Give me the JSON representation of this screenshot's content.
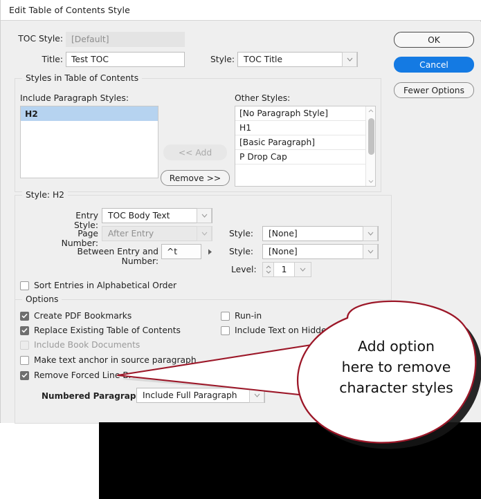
{
  "window": {
    "title": "Edit Table of Contents Style"
  },
  "top": {
    "toc_style_label": "TOC Style:",
    "toc_style_value": "[Default]",
    "title_label": "Title:",
    "title_value": "Test  TOC",
    "title_style_label": "Style:",
    "title_style_value": "TOC Title"
  },
  "buttons": {
    "ok": "OK",
    "cancel": "Cancel",
    "fewer_options": "Fewer Options"
  },
  "styles_group": {
    "legend": "Styles in Table of Contents",
    "include_label": "Include Paragraph Styles:",
    "include_items": [
      "H2"
    ],
    "add_button": "<< Add",
    "remove_button": "Remove >>",
    "other_label": "Other Styles:",
    "other_items": [
      "[No Paragraph Style]",
      "H1",
      "[Basic Paragraph]",
      "P Drop Cap"
    ]
  },
  "style_group": {
    "legend": "Style: H2",
    "entry_style_label": "Entry Style:",
    "entry_style_value": "TOC Body Text",
    "page_number_label": "Page Number:",
    "page_number_value": "After Entry",
    "page_number_style_label": "Style:",
    "page_number_style_value": "[None]",
    "between_label": "Between Entry and Number:",
    "between_value": "^t",
    "between_style_label": "Style:",
    "between_style_value": "[None]",
    "sort_label": "Sort Entries in Alphabetical Order",
    "level_label": "Level:",
    "level_value": "1"
  },
  "options_group": {
    "legend": "Options",
    "left": [
      {
        "label": "Create PDF Bookmarks",
        "checked": true,
        "disabled": false
      },
      {
        "label": "Replace Existing Table of Contents",
        "checked": true,
        "disabled": false
      },
      {
        "label": "Include Book Documents",
        "checked": false,
        "disabled": true
      },
      {
        "label": "Make text anchor in source paragraph",
        "checked": false,
        "disabled": false
      },
      {
        "label": "Remove Forced Line Break",
        "checked": true,
        "disabled": false
      }
    ],
    "right": [
      {
        "label": "Run-in",
        "checked": false,
        "disabled": false
      },
      {
        "label": "Include Text on Hidden Layers",
        "checked": false,
        "disabled": false
      }
    ],
    "numbered_label": "Numbered Paragraphs:",
    "numbered_value": "Include Full Paragraph"
  },
  "callout": {
    "line1": "Add option",
    "line2": "here to remove",
    "line3": "character styles",
    "border_color": "#9c1728",
    "fill_color": "#ffffff",
    "shadow_color": "#111111"
  },
  "icons": {
    "chevron_down": "chevron-down-icon",
    "chevron_up": "chevron-up-icon",
    "checkmark": "check-icon",
    "triangle_right": "triangle-right-icon"
  }
}
